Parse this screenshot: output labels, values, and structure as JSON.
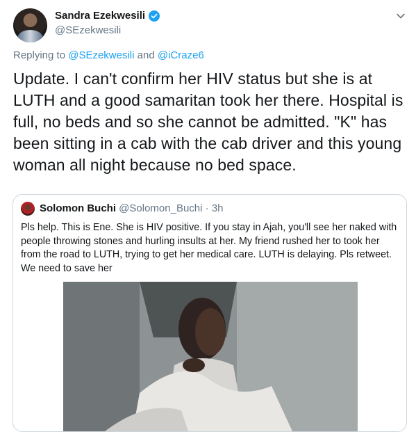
{
  "tweet": {
    "display_name": "Sandra Ezekwesili",
    "handle": "@SEzekwesili",
    "replying_prefix": "Replying to",
    "replying_to": [
      "@SEzekwesili",
      "@iCraze6"
    ],
    "replying_joiner": "and",
    "text": "Update. I can't confirm her HIV status but she is at LUTH and a good samaritan took her there. Hospital is full, no beds and so she cannot be admitted. \"K\" has been sitting in a cab with the cab driver and this young woman all night because no bed space.",
    "icons": {
      "verified": "verified-badge-icon",
      "more": "chevron-down-icon"
    }
  },
  "quoted_tweet": {
    "display_name": "Solomon Buchi",
    "handle": "@Solomon_Buchi",
    "separator": "·",
    "time": "3h",
    "text": "Pls help. This is Ene. She is HIV positive. If you stay in Ajah, you'll see her naked with people throwing stones and hurling insults at her. My friend rushed her to took her from the road to LUTH, trying to get her medical care. LUTH is delaying. Pls retweet. We need to save her"
  },
  "colors": {
    "accent": "#1da1f2",
    "text_primary": "#14171a",
    "text_secondary": "#657786",
    "border": "#ccd6dd"
  }
}
